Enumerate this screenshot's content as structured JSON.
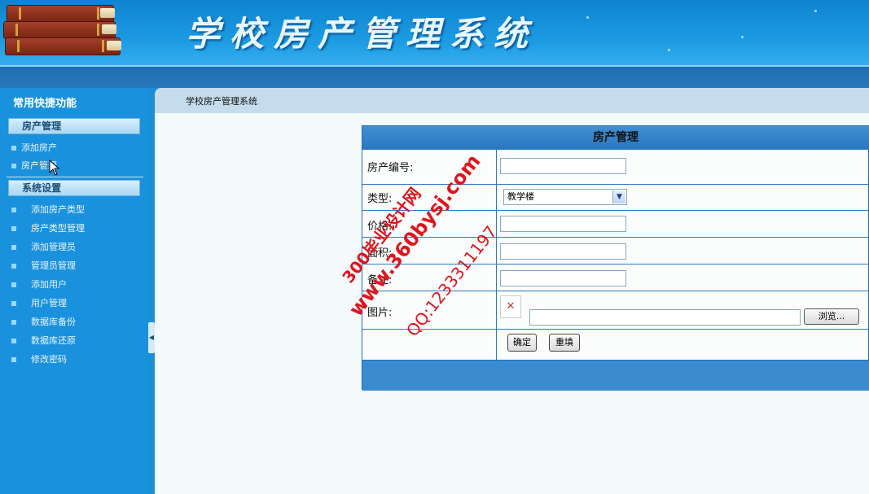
{
  "banner": {
    "title": "学校房产管理系统"
  },
  "sidebar": {
    "title": "常用快捷功能",
    "groups": [
      {
        "label": "房产管理",
        "items": [
          "添加房产",
          "房产管理"
        ]
      },
      {
        "label": "系统设置",
        "items": [
          "添加房产类型",
          "房产类型管理",
          "添加管理员",
          "管理员管理",
          "添加用户",
          "用户管理",
          "数据库备份",
          "数据库还原",
          "修改密码"
        ]
      }
    ]
  },
  "breadcrumb": "学校房产管理系统",
  "form": {
    "title": "房产管理",
    "fields": {
      "code_label": "房产编号:",
      "type_label": "类型:",
      "type_value": "教学楼",
      "price_label": "价格:",
      "area_label": "面积:",
      "remark_label": "备注:",
      "image_label": "图片:"
    },
    "browse_label": "浏览...",
    "submit_label": "确定",
    "reset_label": "重填"
  },
  "watermark": {
    "line1": "300毕业设计网",
    "line2": "www.360bysj.com",
    "line3": "QQ:1233311197"
  },
  "colors": {
    "sidebar": "#1a91dc",
    "banner": "#1c9be2",
    "form_border": "#2b78c0",
    "watermark": "#e0141c"
  }
}
